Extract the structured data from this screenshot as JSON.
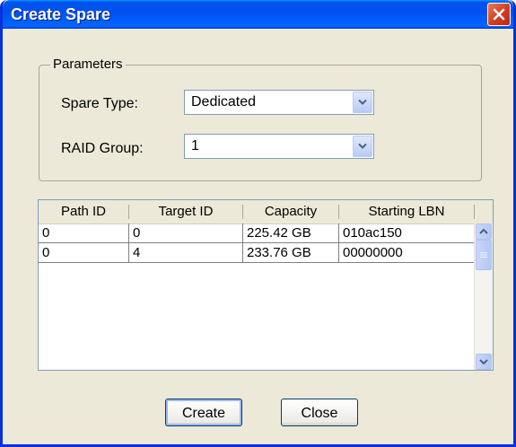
{
  "window": {
    "title": "Create Spare"
  },
  "parameters": {
    "legend": "Parameters",
    "spare_type": {
      "label": "Spare Type:",
      "value": "Dedicated"
    },
    "raid_group": {
      "label": "RAID Group:",
      "value": "1"
    }
  },
  "table": {
    "columns": [
      "Path ID",
      "Target ID",
      "Capacity",
      "Starting LBN"
    ],
    "rows": [
      [
        "0",
        "0",
        "225.42 GB",
        "010ac150"
      ],
      [
        "0",
        "4",
        "233.76 GB",
        "00000000"
      ]
    ]
  },
  "buttons": {
    "create": "Create",
    "close": "Close"
  },
  "colors": {
    "title_bar": "#0053ee",
    "close_button": "#d33b1f",
    "dialog_bg": "#ece9d8"
  }
}
